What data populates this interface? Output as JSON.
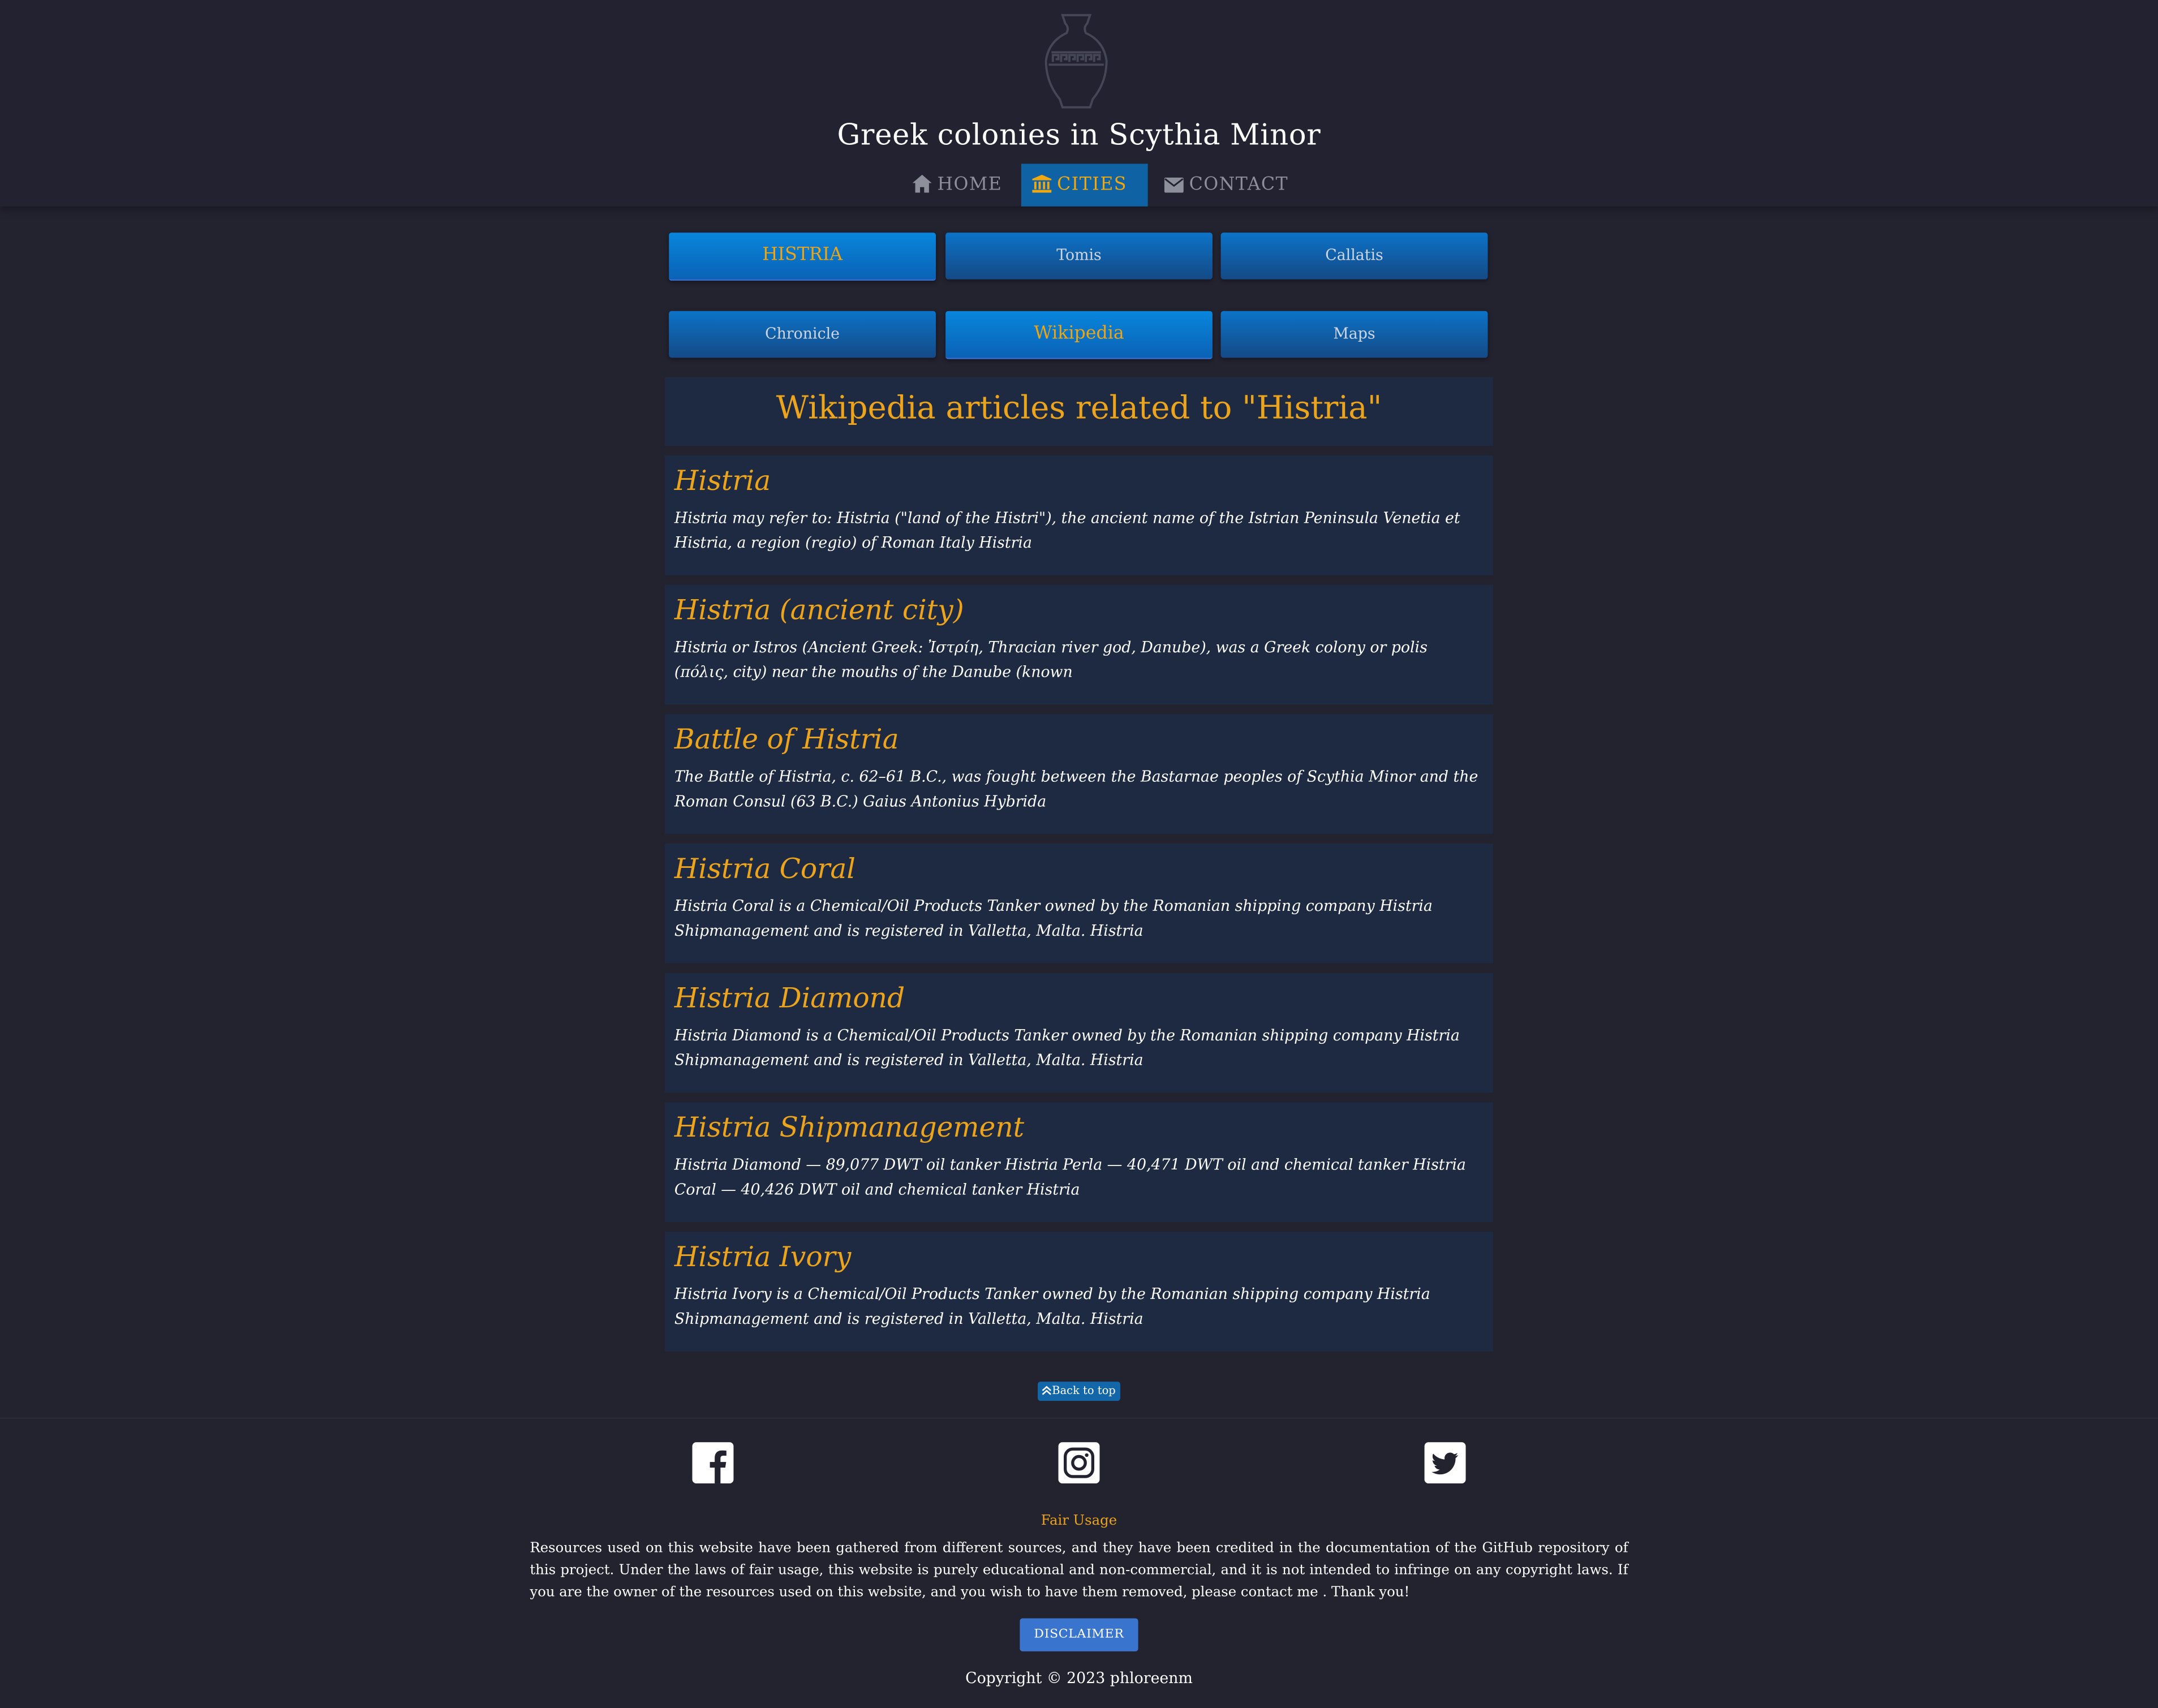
{
  "site": {
    "title": "Greek colonies in Scythia Minor"
  },
  "nav": {
    "items": [
      {
        "label": "HOME",
        "icon": "home-icon"
      },
      {
        "label": "CITIES",
        "icon": "museum-icon",
        "active": true
      },
      {
        "label": "CONTACT",
        "icon": "envelope-icon"
      }
    ]
  },
  "cities": [
    {
      "label": "HISTRIA",
      "active": true
    },
    {
      "label": "Tomis",
      "active": false
    },
    {
      "label": "Callatis",
      "active": false
    }
  ],
  "sections": [
    {
      "label": "Chronicle",
      "active": false
    },
    {
      "label": "Wikipedia",
      "active": true
    },
    {
      "label": "Maps",
      "active": false
    }
  ],
  "wiki": {
    "heading": "Wikipedia articles related to \"Histria\"",
    "articles": [
      {
        "title": "Histria",
        "text": "Histria may refer to: Histria (\"land of the Histri\"), the ancient name of the Istrian Peninsula Venetia et Histria, a region (regio) of Roman Italy Histria"
      },
      {
        "title": "Histria (ancient city)",
        "text": "Histria or Istros (Ancient Greek: Ἰστρίη, Thracian river god, Danube), was a Greek colony or polis (πόλις, city) near the mouths of the Danube (known"
      },
      {
        "title": "Battle of Histria",
        "text": "The Battle of Histria, c. 62–61 B.C., was fought between the Bastarnae peoples of Scythia Minor and the Roman Consul (63 B.C.) Gaius Antonius Hybrida"
      },
      {
        "title": "Histria Coral",
        "text": "Histria Coral is a Chemical/Oil Products Tanker owned by the Romanian shipping company Histria Shipmanagement and is registered in Valletta, Malta. Histria"
      },
      {
        "title": "Histria Diamond",
        "text": "Histria Diamond is a Chemical/Oil Products Tanker owned by the Romanian shipping company Histria Shipmanagement and is registered in Valletta, Malta. Histria"
      },
      {
        "title": "Histria Shipmanagement",
        "text": "Histria Diamond — 89,077 DWT oil tanker Histria Perla — 40,471 DWT oil and chemical tanker Histria Coral — 40,426 DWT oil and chemical tanker Histria"
      },
      {
        "title": "Histria Ivory",
        "text": "Histria Ivory is a Chemical/Oil Products Tanker owned by the Romanian shipping company Histria Shipmanagement and is registered in Valletta, Malta. Histria"
      }
    ]
  },
  "back_to_top": "Back to top",
  "footer": {
    "social": [
      "facebook-icon",
      "instagram-icon",
      "twitter-icon"
    ],
    "fair_title": "Fair Usage",
    "fair_text": "Resources used on this website have been gathered from different sources, and they have been credited in the documentation of the GitHub repository of this project. Under the laws of fair usage, this website is purely educational and non-commercial, and it is not intended to infringe on any copyright laws. If you are the owner of the resources used on this website, and you wish to have them removed, please contact me . Thank you!",
    "disclaimer": "DISCLAIMER",
    "copyright": "Copyright © 2023 phloreenm"
  },
  "colors": {
    "background": "#23222f",
    "accent": "#eca41c",
    "button_blue": "#0f63a5",
    "card": "#1e2a42"
  }
}
